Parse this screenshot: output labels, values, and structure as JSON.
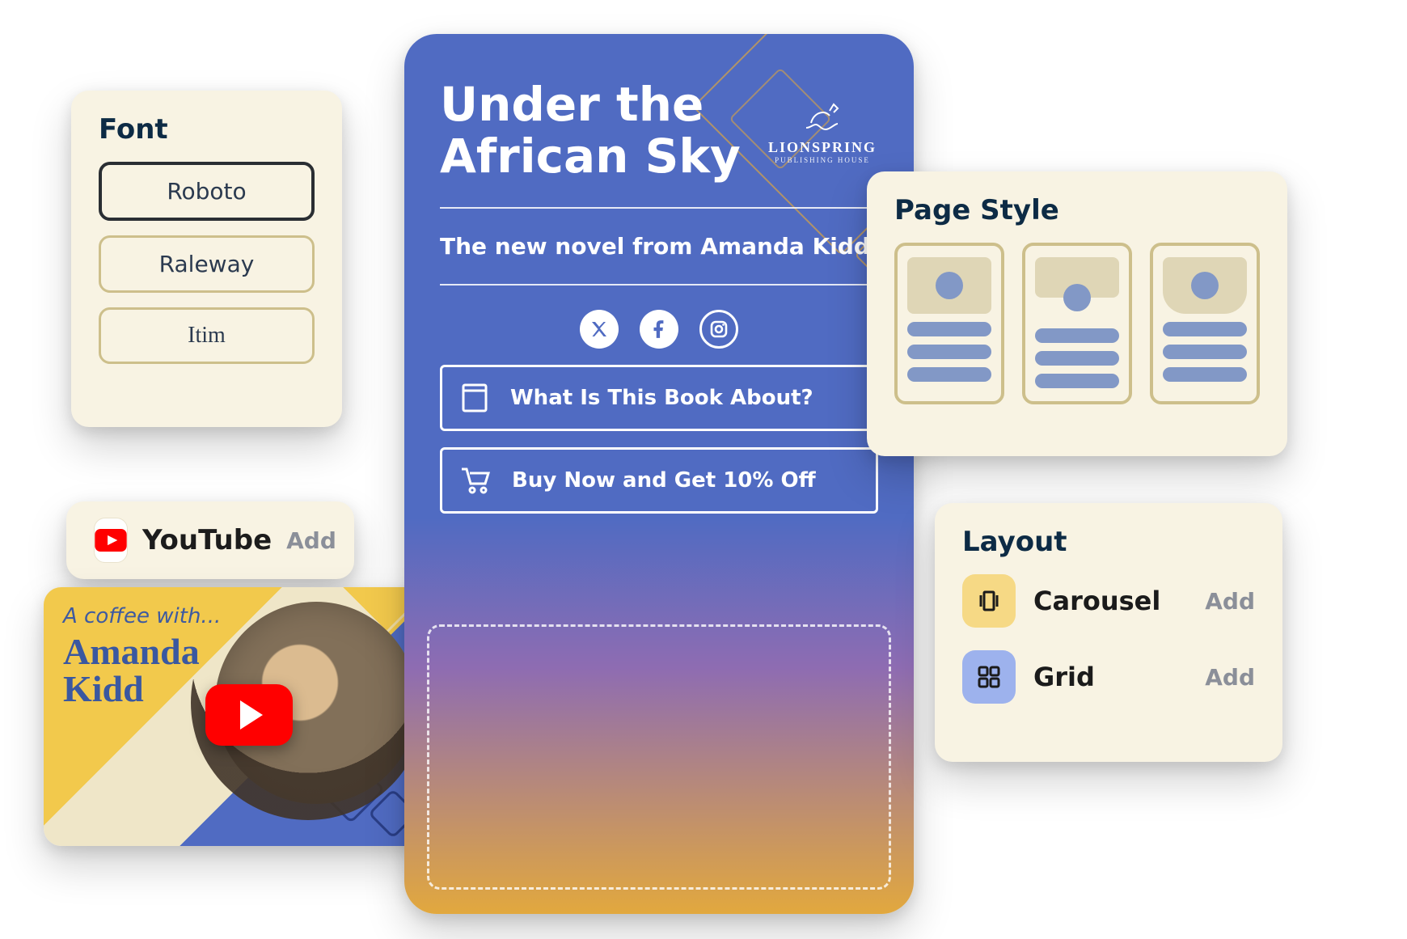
{
  "font_panel": {
    "title": "Font",
    "options": [
      "Roboto",
      "Raleway",
      "Itim"
    ],
    "selected": 0
  },
  "youtube_card": {
    "label": "YouTube",
    "action": "Add",
    "icon": "youtube-logo-icon"
  },
  "video_card": {
    "overline": "A coffee with...",
    "title_line1": "Amanda",
    "title_line2": "Kidd",
    "play_icon": "play-icon",
    "publisher_mark_icon": "lionspring-mark-icon"
  },
  "phone_preview": {
    "title_line1": "Under the",
    "title_line2": "African Sky",
    "subtitle": "The new novel from Amanda Kidd",
    "publisher": {
      "name": "LIONSPRING",
      "tagline": "PUBLISHING HOUSE"
    },
    "socials": [
      {
        "name": "x-icon"
      },
      {
        "name": "facebook-icon"
      },
      {
        "name": "instagram-icon"
      }
    ],
    "links": [
      {
        "icon": "book-icon",
        "label": "What Is This Book About?"
      },
      {
        "icon": "cart-icon",
        "label": "Buy Now and Get 10% Off"
      }
    ]
  },
  "page_style_panel": {
    "title": "Page Style",
    "templates": [
      "template-a",
      "template-b",
      "template-c"
    ]
  },
  "layout_panel": {
    "title": "Layout",
    "options": [
      {
        "icon": "carousel-icon",
        "label": "Carousel",
        "action": "Add",
        "color": "yellow"
      },
      {
        "icon": "grid-icon",
        "label": "Grid",
        "action": "Add",
        "color": "blue"
      }
    ]
  },
  "colors": {
    "cream": "#F8F3E3",
    "navy": "#0D2B45",
    "blue": "#506BC2",
    "gold": "#D9A443",
    "yellow": "#F2C94C",
    "muted_blue": "#8298C6",
    "gray": "#8B8F99"
  }
}
